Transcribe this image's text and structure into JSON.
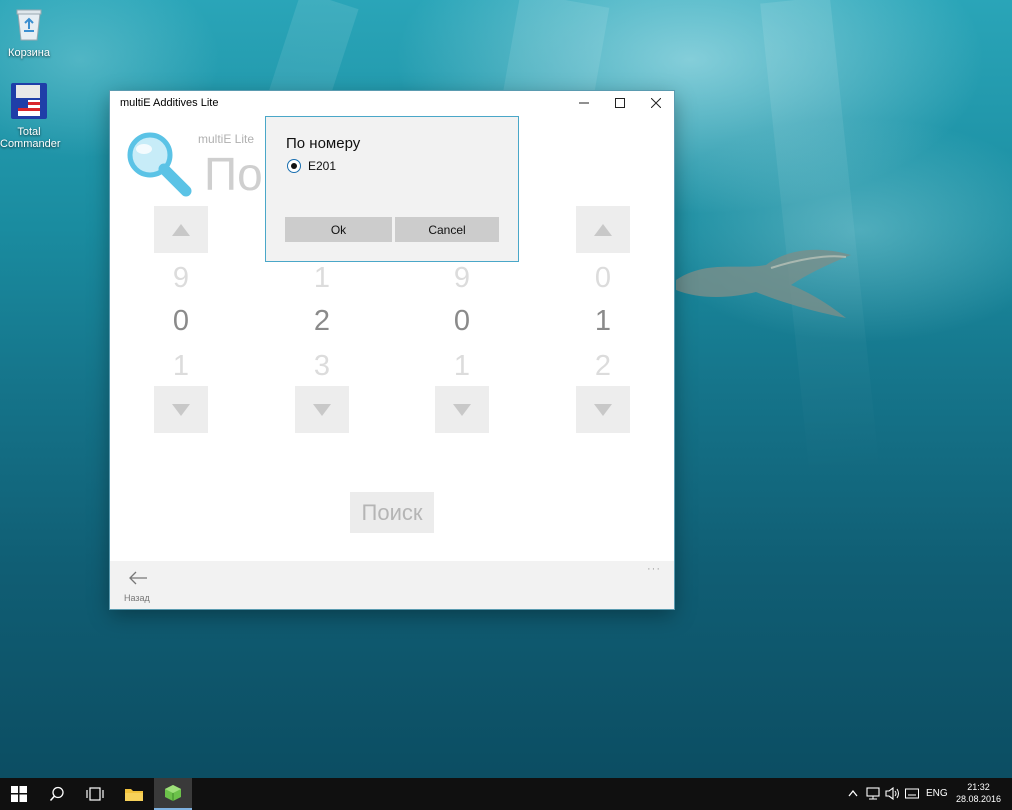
{
  "desktop": {
    "icons": [
      {
        "label": "Корзина",
        "icon": "recycle-bin-icon"
      },
      {
        "label": "Total Commander",
        "icon": "total-commander-icon"
      }
    ]
  },
  "window": {
    "title": "multiE Additives Lite",
    "controls": {
      "minimize": "—",
      "maximize": "☐",
      "close": "✕"
    },
    "header": {
      "subtitle": "multiE Lite",
      "title": "По"
    },
    "pickers": [
      {
        "prev": "9",
        "current": "0",
        "next": "1"
      },
      {
        "prev": "1",
        "current": "2",
        "next": "3"
      },
      {
        "prev": "9",
        "current": "0",
        "next": "1"
      },
      {
        "prev": "0",
        "current": "1",
        "next": "2"
      }
    ],
    "search_button": "Поиск",
    "appbar": {
      "back_label": "Назад",
      "more": "···"
    }
  },
  "dialog": {
    "title": "По номеру",
    "option": {
      "label": "E201",
      "selected": true
    },
    "ok": "Ok",
    "cancel": "Cancel"
  },
  "taskbar": {
    "language": "ENG",
    "time": "21:32",
    "date": "28.08.2016"
  },
  "colors": {
    "dialog_border": "#4aa7c8",
    "taskbar": "#101010",
    "dialog_button": "#cccccc",
    "search_icon": "#5bc3e6"
  }
}
